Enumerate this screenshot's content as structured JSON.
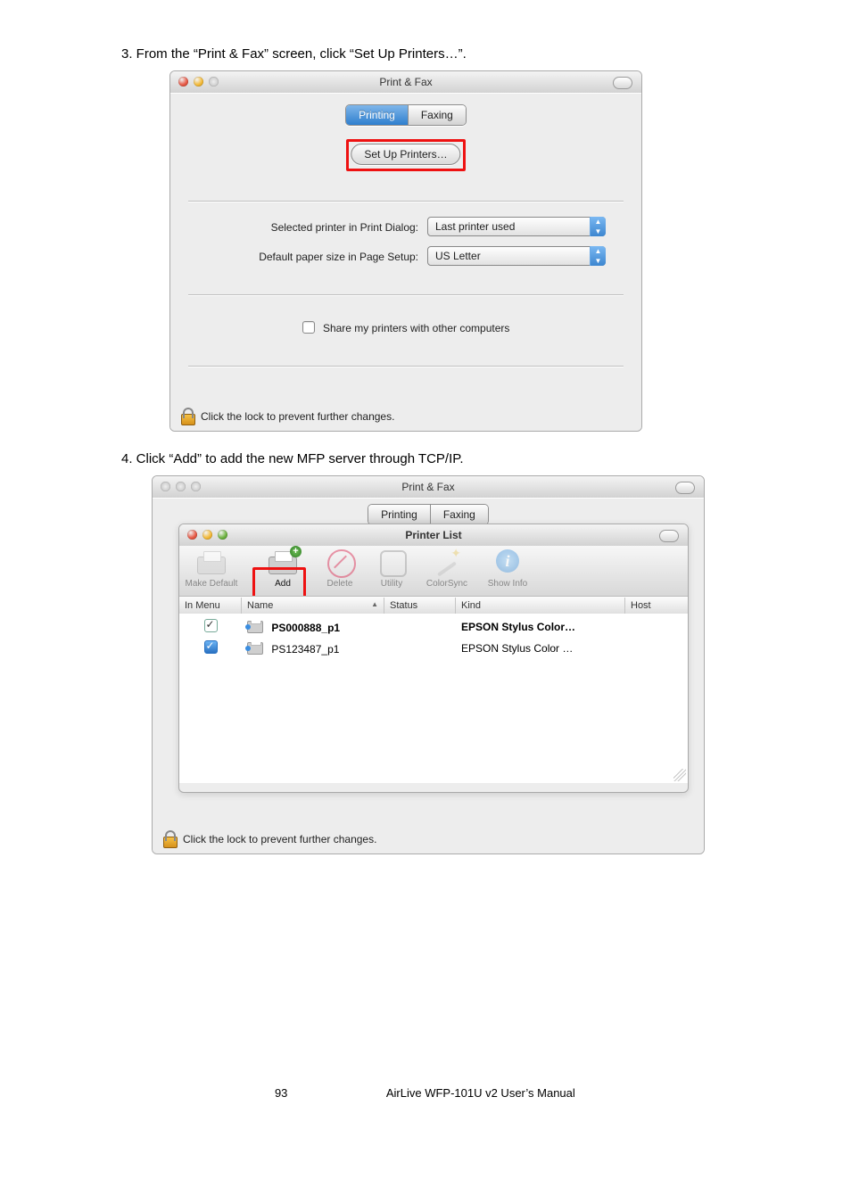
{
  "steps": {
    "s3": "3.  From the “Print & Fax” screen, click “Set Up Printers…”.",
    "s4": "4.  Click “Add” to add the new MFP server through TCP/IP."
  },
  "win1": {
    "title": "Print & Fax",
    "tab_printing": "Printing",
    "tab_faxing": "Faxing",
    "setup_btn": "Set Up Printers…",
    "row1_label": "Selected printer in Print Dialog:",
    "row1_value": "Last printer used",
    "row2_label": "Default paper size in Page Setup:",
    "row2_value": "US Letter",
    "share_text": "Share my printers with other computers",
    "lock_text": "Click the lock to prevent further changes."
  },
  "win2": {
    "outer_title": "Print & Fax",
    "tab_printing": "Printing",
    "tab_faxing": "Faxing",
    "inner_title": "Printer List",
    "tb": {
      "make_default": "Make Default",
      "add": "Add",
      "delete": "Delete",
      "utility": "Utility",
      "colorsync": "ColorSync",
      "show_info": "Show Info"
    },
    "cols": {
      "in_menu": "In Menu",
      "name": "Name",
      "status": "Status",
      "kind": "Kind",
      "host": "Host"
    },
    "rows": [
      {
        "checked": true,
        "blue": false,
        "name": "PS000888_p1",
        "kind": "EPSON Stylus Color…"
      },
      {
        "checked": true,
        "blue": true,
        "name": "PS123487_p1",
        "kind": "EPSON Stylus Color …"
      }
    ],
    "lock_text": "Click the lock to prevent further changes."
  },
  "footer": {
    "page": "93",
    "doc": "AirLive WFP-101U v2 User’s Manual"
  }
}
